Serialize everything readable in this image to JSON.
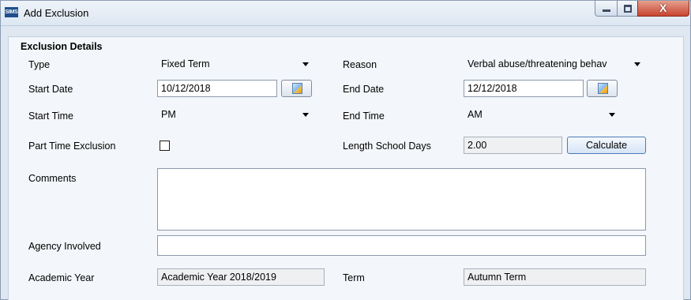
{
  "window": {
    "app_icon_text": "SIMS",
    "title": "Add Exclusion",
    "controls": {
      "close_glyph": "X"
    }
  },
  "section": {
    "title": "Exclusion Details"
  },
  "form": {
    "type": {
      "label": "Type",
      "value": "Fixed Term"
    },
    "reason": {
      "label": "Reason",
      "value": "Verbal abuse/threatening behav"
    },
    "start_date": {
      "label": "Start Date",
      "value": "10/12/2018"
    },
    "end_date": {
      "label": "End Date",
      "value": "12/12/2018"
    },
    "start_time": {
      "label": "Start Time",
      "value": "PM"
    },
    "end_time": {
      "label": "End Time",
      "value": "AM"
    },
    "part_time": {
      "label": "Part Time Exclusion",
      "checked": false
    },
    "length": {
      "label": "Length School Days",
      "value": "2.00",
      "button": "Calculate"
    },
    "comments": {
      "label": "Comments",
      "value": ""
    },
    "agency": {
      "label": "Agency Involved",
      "value": ""
    },
    "academic_year": {
      "label": "Academic Year",
      "value": "Academic Year 2018/2019"
    },
    "term": {
      "label": "Term",
      "value": "Autumn Term"
    }
  },
  "icons": {
    "dropdown": "chevron-down-icon",
    "calendar": "calendar-icon",
    "minimize": "minimize-icon",
    "maximize": "maximize-icon",
    "close": "close-icon"
  },
  "colors": {
    "title_bar": "#dde7f2",
    "panel_background": "#f3f6fa",
    "close_button": "#c7452f",
    "button_border": "#4c7ab9"
  }
}
